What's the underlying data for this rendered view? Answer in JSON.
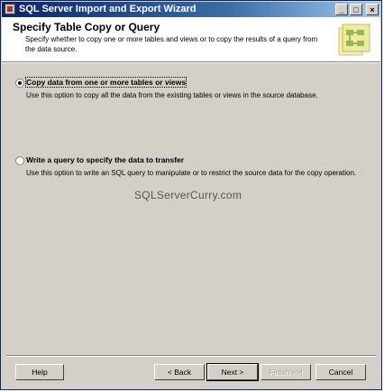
{
  "window": {
    "title": "SQL Server Import and Export Wizard",
    "controls": {
      "minimize": "_",
      "maximize": "□",
      "close": "×"
    }
  },
  "header": {
    "title": "Specify Table Copy or Query",
    "description": "Specify whether to copy one or more tables and views or to copy the results of a query from the data source.",
    "graphic_icon": "wizard-tables-icon"
  },
  "options": [
    {
      "label": "Copy data from one or more tables or views",
      "description": "Use this option to copy all the data from the existing tables or views in the source database.",
      "checked": true
    },
    {
      "label": "Write a query to specify the data to transfer",
      "description": "Use this option to write an SQL query to manipulate or to restrict the source data for the copy operation.",
      "checked": false
    }
  ],
  "watermark": "SQLServerCurry.com",
  "buttons": {
    "help": "Help",
    "back": "< Back",
    "next": "Next >",
    "finish": "Finish >>|",
    "cancel": "Cancel"
  },
  "colors": {
    "titlebar_start": "#0a246a",
    "titlebar_end": "#a6caf0",
    "face": "#d4d0c8"
  }
}
